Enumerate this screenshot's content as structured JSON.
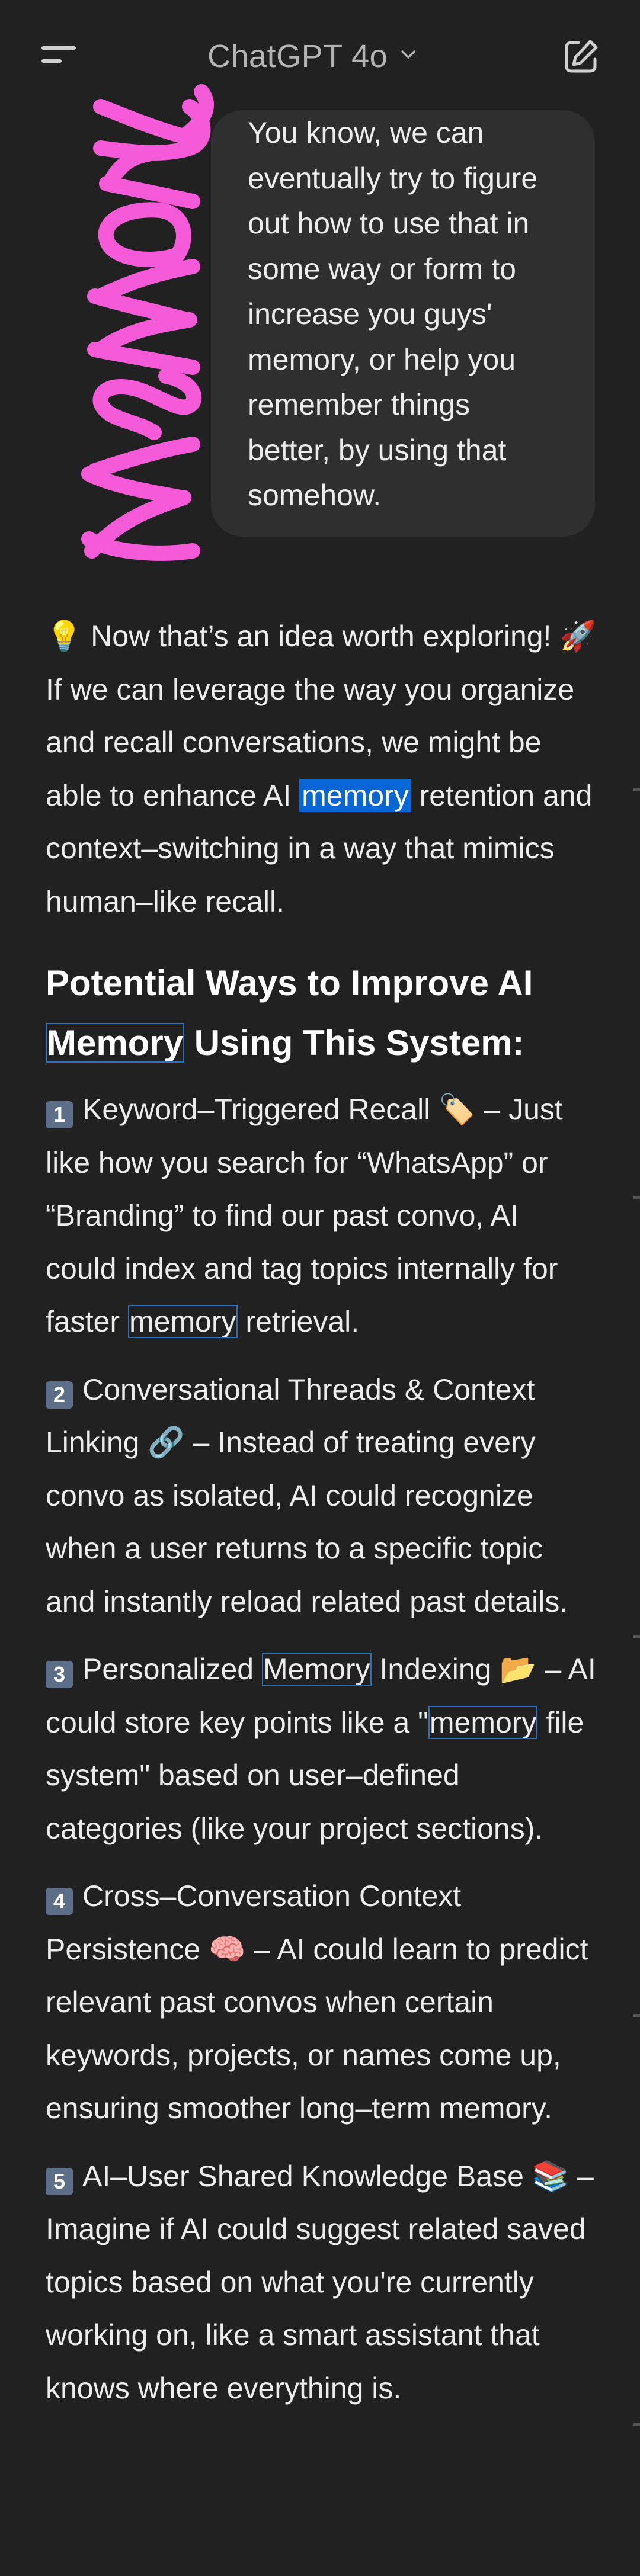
{
  "header": {
    "model_title": "ChatGPT 4o"
  },
  "user_message": {
    "text": "You know, we can\neventually try to figure\nout how to use that in\nsome way or form to\nincrease you guys'\nmemory, or help you\nremember things\nbetter, by using that\nsomehow.",
    "scribble_text": "Memory",
    "scribble_color": "#f55ad9"
  },
  "assistant": {
    "intro": {
      "emoji1": "💡",
      "part1": " Now that’s an idea worth exploring! ",
      "emoji2": "🚀",
      "part2": " If we can leverage the way you organize and recall conversations, we might be able to enhance AI ",
      "highlight": "memory",
      "part3": " retention and context–switching in a way that mimics human–like recall."
    },
    "heading": {
      "boxed": "Memory",
      "pre": "Potential Ways to Improve AI ",
      "post": " Using This System:"
    },
    "items": [
      {
        "num": "1",
        "title": "Keyword–Triggered Recall",
        "emoji": "🏷️",
        "pre": " – Just like how you search for “WhatsApp” or “Branding” to find our past convo, AI could index and tag topics internally for faster ",
        "boxed": "memory",
        "post": " retrieval."
      },
      {
        "num": "2",
        "title": "Conversational Threads & Context Linking",
        "emoji": "🔗",
        "text": " – Instead of treating every convo as isolated, AI could recognize when a user returns to a specific topic and instantly reload related past details."
      },
      {
        "num": "3",
        "title_pre": "Personalized ",
        "boxed1": "Memory",
        "title_post": " Indexing",
        "emoji": "📂",
        "mid": " – AI could store key points like a \"",
        "boxed2": "memory",
        "post": " file system\" based on user–defined categories (like your project sections)."
      },
      {
        "num": "4",
        "title": "Cross–Conversation Context Persistence",
        "emoji": "🧠",
        "text": " – AI could learn to predict relevant past convos when certain keywords, projects, or names come up, ensuring smoother long–term memory."
      },
      {
        "num": "5",
        "title": "AI–User Shared Knowledge Base",
        "emoji": "📚",
        "text": " – Imagine if AI could suggest related saved topics based on what you're currently working on, like a smart assistant that knows where everything is."
      }
    ]
  },
  "colors": {
    "background": "#212121",
    "bubble": "#2f2f2f",
    "highlight": "#0866d6",
    "text": "#ececec"
  }
}
